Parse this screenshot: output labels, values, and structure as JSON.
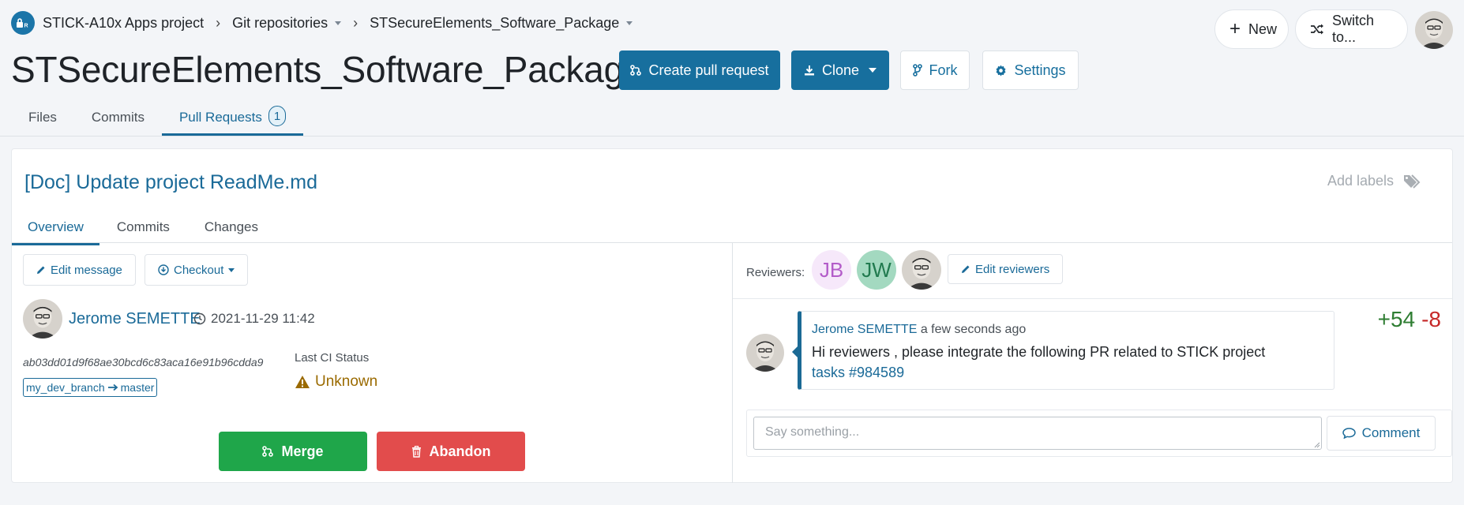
{
  "breadcrumb": {
    "project": "STICK-A10x Apps project",
    "repos": "Git repositories",
    "repo": "STSecureElements_Software_Package"
  },
  "repo_title": "STSecureElements_Software_Package",
  "actions": {
    "create_pr": "Create pull request",
    "clone": "Clone",
    "fork": "Fork",
    "settings": "Settings"
  },
  "top_right": {
    "new": "New",
    "switch_to": "Switch to..."
  },
  "tabs": {
    "files": "Files",
    "commits": "Commits",
    "pull_requests": "Pull Requests",
    "pr_count": "1"
  },
  "pr": {
    "title": "[Doc] Update project ReadMe.md",
    "add_labels": "Add labels",
    "tabs": {
      "overview": "Overview",
      "commits": "Commits",
      "changes": "Changes"
    },
    "edit_message": "Edit message",
    "checkout": "Checkout",
    "author": "Jerome SEMETTE",
    "date": "2021-11-29 11:42",
    "additions": "+54",
    "deletions": "-8",
    "commit_hash": "ab03dd01d9f68ae30bcd6c83aca16e91b96cdda9",
    "source_branch": "my_dev_branch",
    "target_branch": "master",
    "ci_label": "Last CI Status",
    "ci_status": "Unknown",
    "merge": "Merge",
    "abandon": "Abandon"
  },
  "reviewers": {
    "label": "Reviewers:",
    "r1": "JB",
    "r2": "JW",
    "edit": "Edit reviewers"
  },
  "comment": {
    "author": "Jerome SEMETTE",
    "time": "a few seconds ago",
    "text": "Hi reviewers , please integrate the following PR related to STICK project",
    "link": "tasks #984589"
  },
  "compose": {
    "placeholder": "Say something...",
    "button": "Comment"
  },
  "colors": {
    "primary": "#176f9e",
    "merge": "#1fa64a",
    "abandon": "#e24c4c",
    "plus": "#2e7d32",
    "minus": "#c62828"
  }
}
